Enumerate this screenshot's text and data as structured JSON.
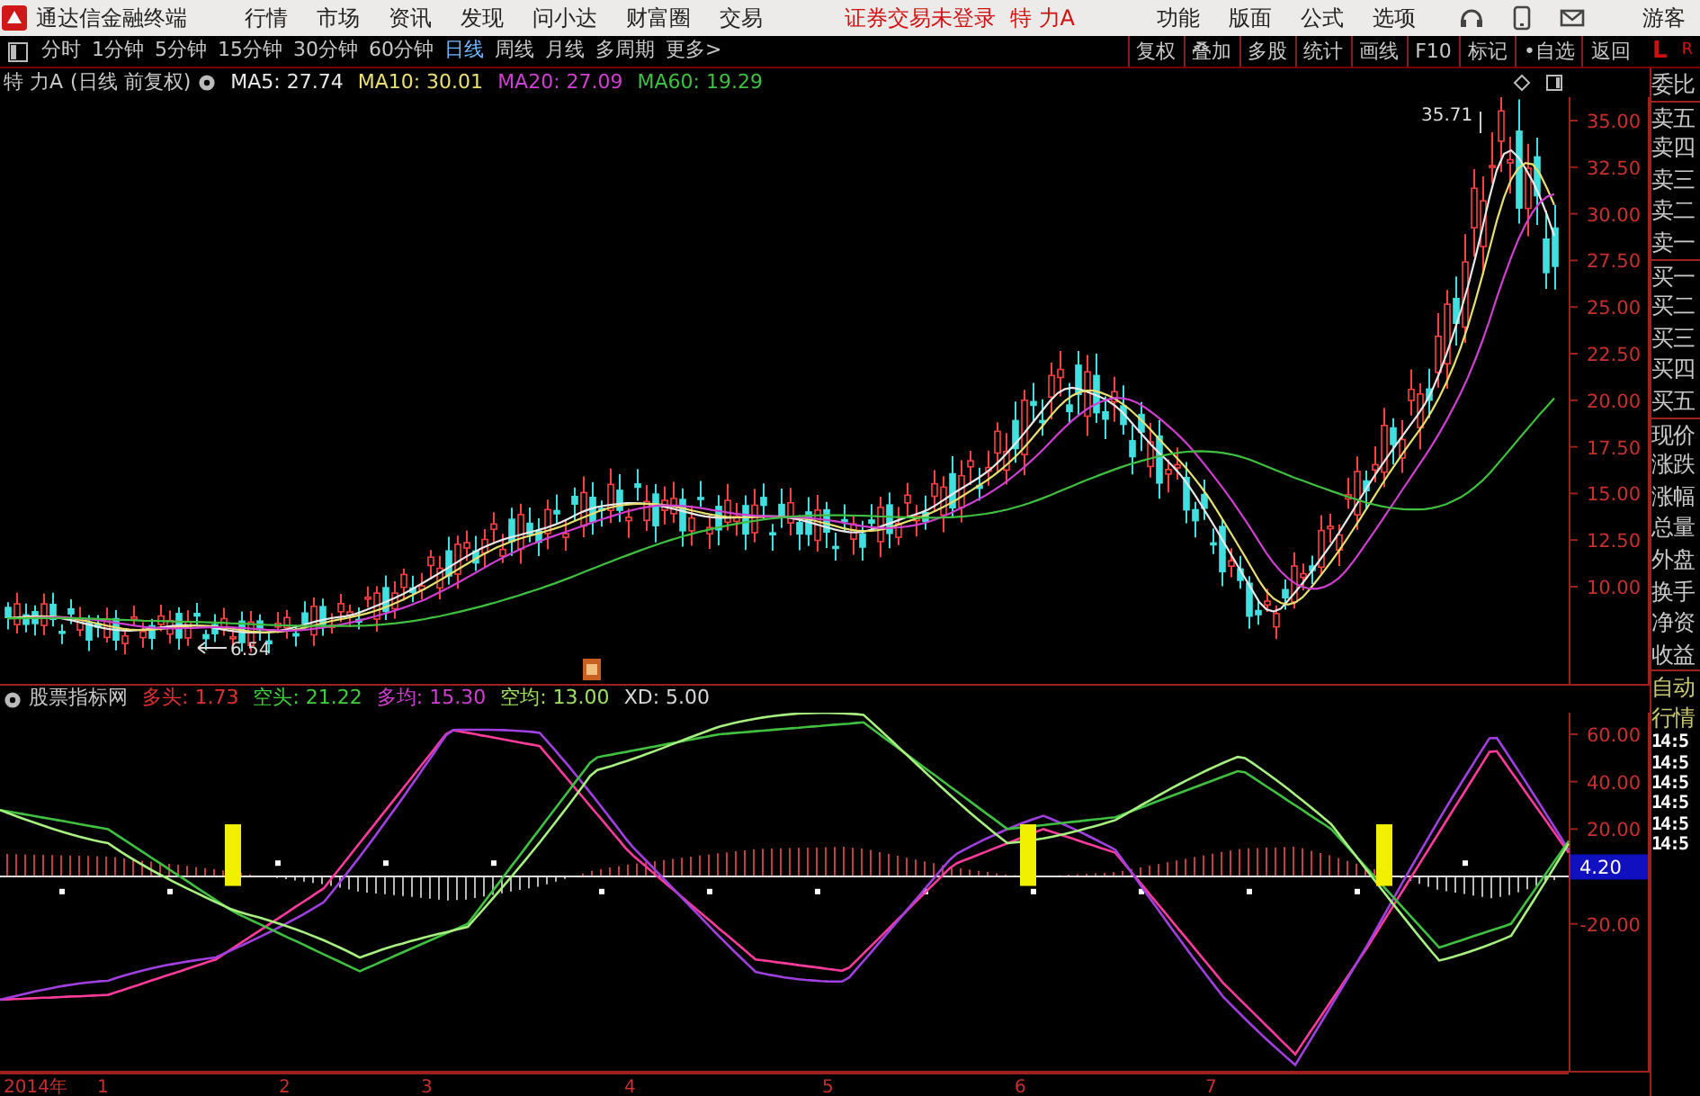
{
  "top_menu": {
    "app_title": "通达信金融终端",
    "items": [
      "行情",
      "市场",
      "资讯",
      "发现",
      "问小达",
      "财富圈",
      "交易"
    ],
    "login_status": "证券交易未登录",
    "stock": "特 力A",
    "right_items": [
      "功能",
      "版面",
      "公式",
      "选项"
    ],
    "user": "游客"
  },
  "toolbar": {
    "periods": [
      {
        "label": "分时",
        "selected": false
      },
      {
        "label": "1分钟",
        "selected": false
      },
      {
        "label": "5分钟",
        "selected": false
      },
      {
        "label": "15分钟",
        "selected": false
      },
      {
        "label": "30分钟",
        "selected": false
      },
      {
        "label": "60分钟",
        "selected": false
      },
      {
        "label": "日线",
        "selected": true
      },
      {
        "label": "周线",
        "selected": false
      },
      {
        "label": "月线",
        "selected": false
      },
      {
        "label": "多周期",
        "selected": false
      }
    ],
    "more": "更多>",
    "buttons": [
      "复权",
      "叠加",
      "多股",
      "统计",
      "画线",
      "F10",
      "标记",
      "•自选",
      "返回"
    ],
    "corner_left": "L",
    "corner_right": "R"
  },
  "price_chart": {
    "stock": "特 力A",
    "mode": "(日线 前复权)",
    "moving_averages": [
      {
        "label": "MA5: 27.74",
        "color": "#e8e8e8"
      },
      {
        "label": "MA10: 30.01",
        "color": "#e8e070"
      },
      {
        "label": "MA20: 27.09",
        "color": "#d040d0"
      },
      {
        "label": "MA60: 19.29",
        "color": "#40c040"
      }
    ],
    "y_axis": [
      "35.00",
      "32.50",
      "30.00",
      "27.50",
      "25.00",
      "22.50",
      "20.00",
      "17.50",
      "15.00",
      "12.50",
      "10.00"
    ],
    "high_label": "35.71",
    "low_label": "6.54"
  },
  "indicator": {
    "name": "股票指标网",
    "values": [
      {
        "label": "多头: 1.73",
        "color": "#e03030"
      },
      {
        "label": "空头: 21.22",
        "color": "#40d040"
      },
      {
        "label": "多均: 15.30",
        "color": "#d040d0"
      },
      {
        "label": "空均: 13.00",
        "color": "#a0e060"
      },
      {
        "label": "XD: 5.00",
        "color": "#d8d8d8"
      }
    ],
    "y_axis": [
      "60.00",
      "40.00",
      "20.00",
      "-20.00"
    ],
    "current": "4.20"
  },
  "time_axis": [
    "2014年",
    "1",
    "2",
    "3",
    "4",
    "5",
    "6",
    "7"
  ],
  "quote_panel": {
    "items": [
      "委比",
      "卖五",
      "卖四",
      "卖三",
      "卖二",
      "卖一",
      "买一",
      "买二",
      "买三",
      "买四",
      "买五",
      "现价",
      "涨跌",
      "涨幅",
      "总量",
      "外盘",
      "换手",
      "净资",
      "收益"
    ],
    "mode_items": [
      "自动",
      "行情"
    ],
    "times": [
      "14:5",
      "14:5",
      "14:5",
      "14:5",
      "14:5",
      "14:5"
    ]
  }
}
